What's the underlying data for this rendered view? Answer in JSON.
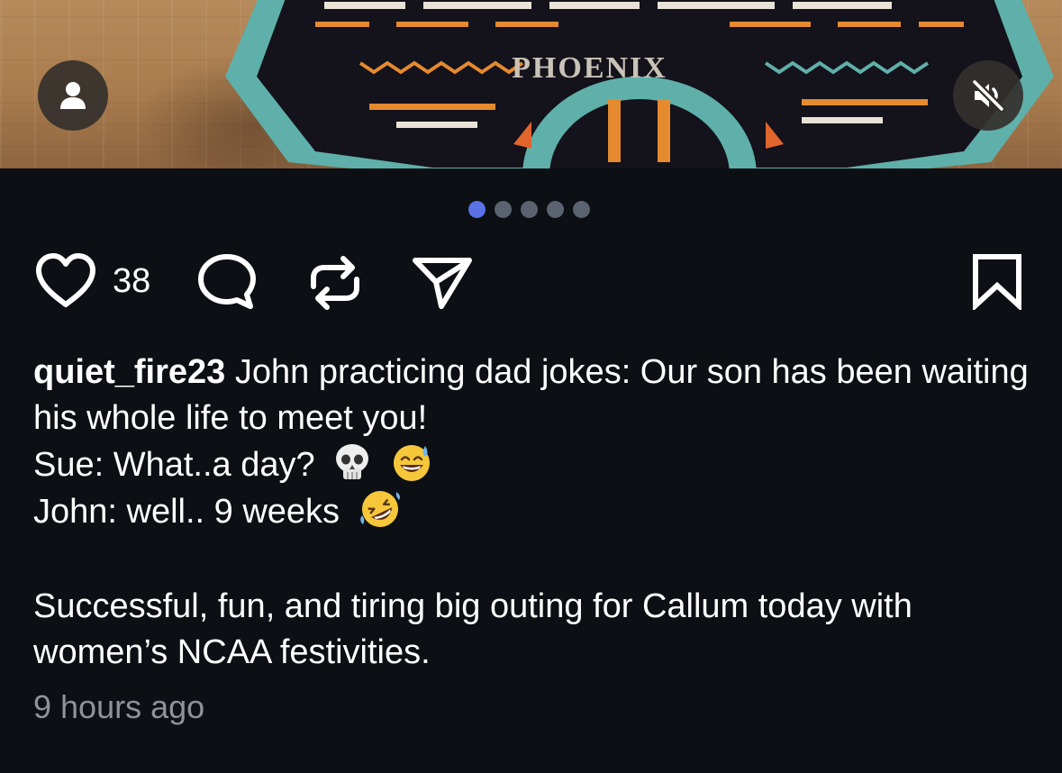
{
  "media": {
    "logo_text": "PHOENIX",
    "carousel": {
      "count": 5,
      "active_index": 0
    }
  },
  "actions": {
    "like_count": "38"
  },
  "post": {
    "username": "quiet_fire23",
    "caption_lines": [
      "John practicing dad jokes: Our son has been waiting his whole life to meet you!",
      "Sue: What..a day?",
      "John: well.. 9 weeks",
      "Successful, fun, and tiring big outing for Callum today with women’s NCAA festivities."
    ],
    "emojis": {
      "line2": [
        "skull-emoji",
        "grinning-sweat-emoji"
      ],
      "line3": [
        "rolling-laughing-emoji"
      ]
    },
    "timestamp": "9 hours ago"
  },
  "colors": {
    "background": "#0c0f14",
    "dot_active": "#5a72e6",
    "dot_inactive": "#5b6371",
    "muted_text": "#8e939b"
  }
}
